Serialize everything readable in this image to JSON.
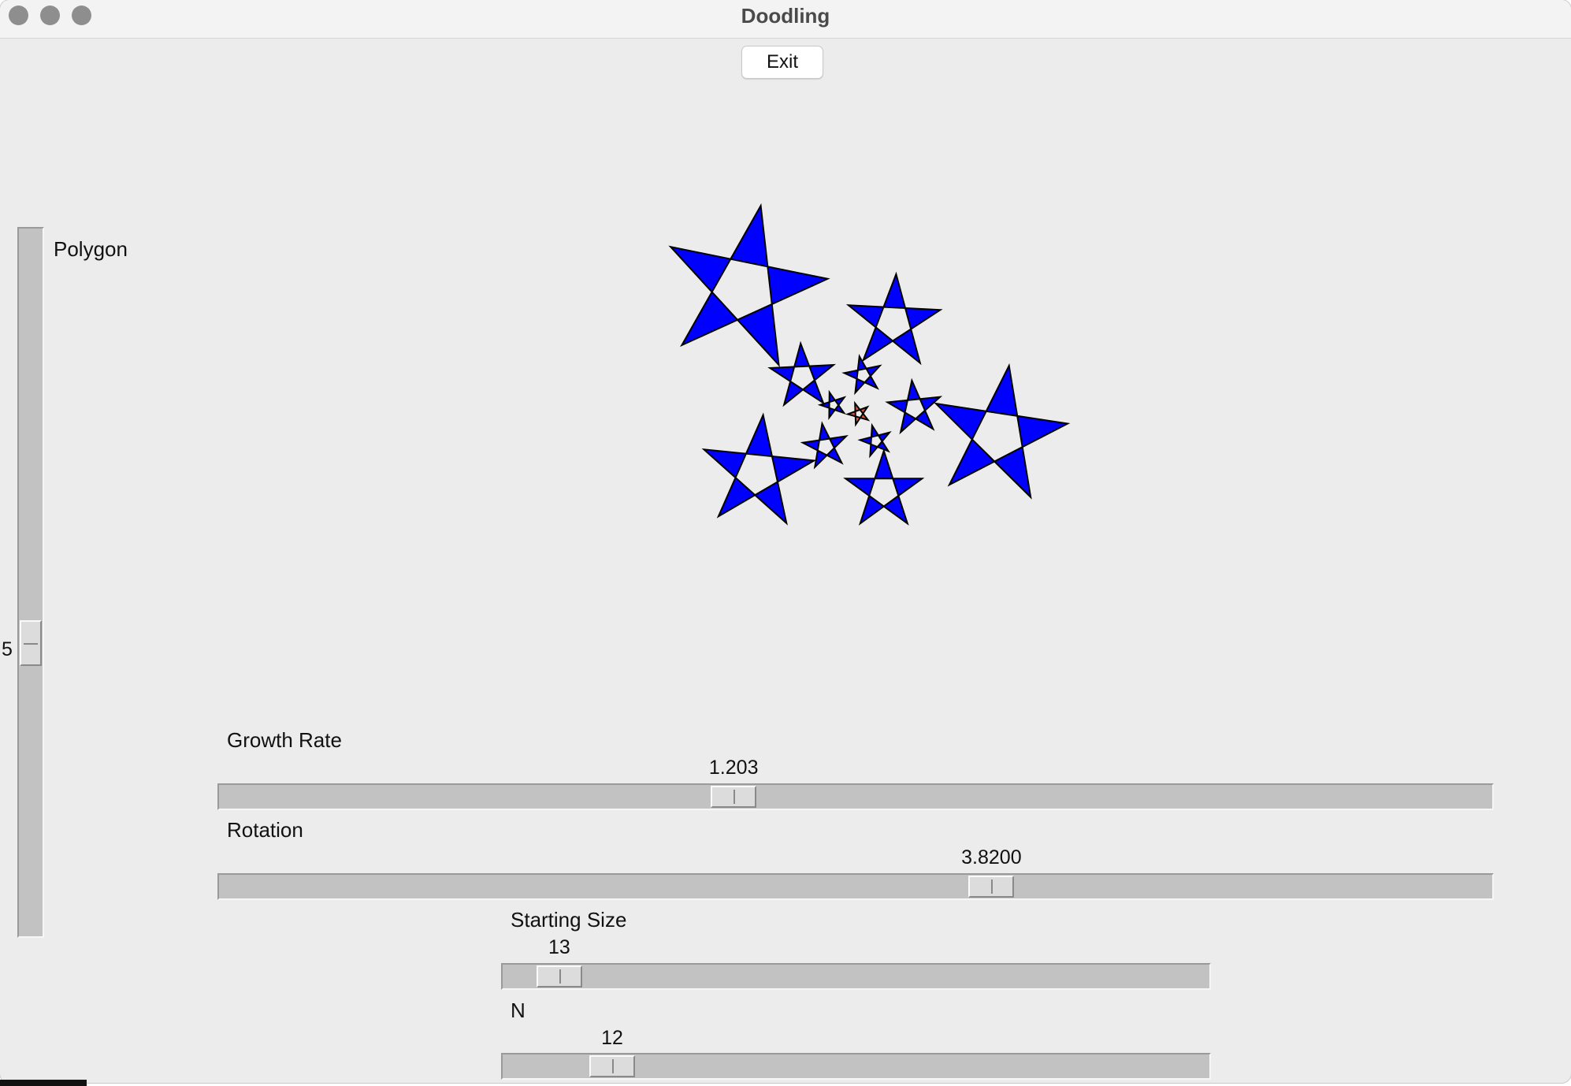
{
  "window": {
    "title": "Doodling"
  },
  "toolbar": {
    "exit_label": "Exit"
  },
  "colors": {
    "star_fill": "#0000ff",
    "center_star_fill": "#e8553a",
    "stroke": "#000000"
  },
  "sliders": {
    "polygon": {
      "label": "Polygon",
      "value": "5",
      "orientation": "vertical",
      "fraction": 0.59
    },
    "growth_rate": {
      "label": "Growth Rate",
      "value": "1.203",
      "orientation": "horizontal",
      "fraction": 0.4
    },
    "rotation": {
      "label": "Rotation",
      "value": "3.8200",
      "orientation": "horizontal",
      "fraction": 0.61
    },
    "starting_size": {
      "label": "Starting Size",
      "value": "13",
      "orientation": "horizontal",
      "fraction": 0.05
    },
    "n": {
      "label": "N",
      "value": "12",
      "orientation": "horizontal",
      "fraction": 0.13
    }
  }
}
